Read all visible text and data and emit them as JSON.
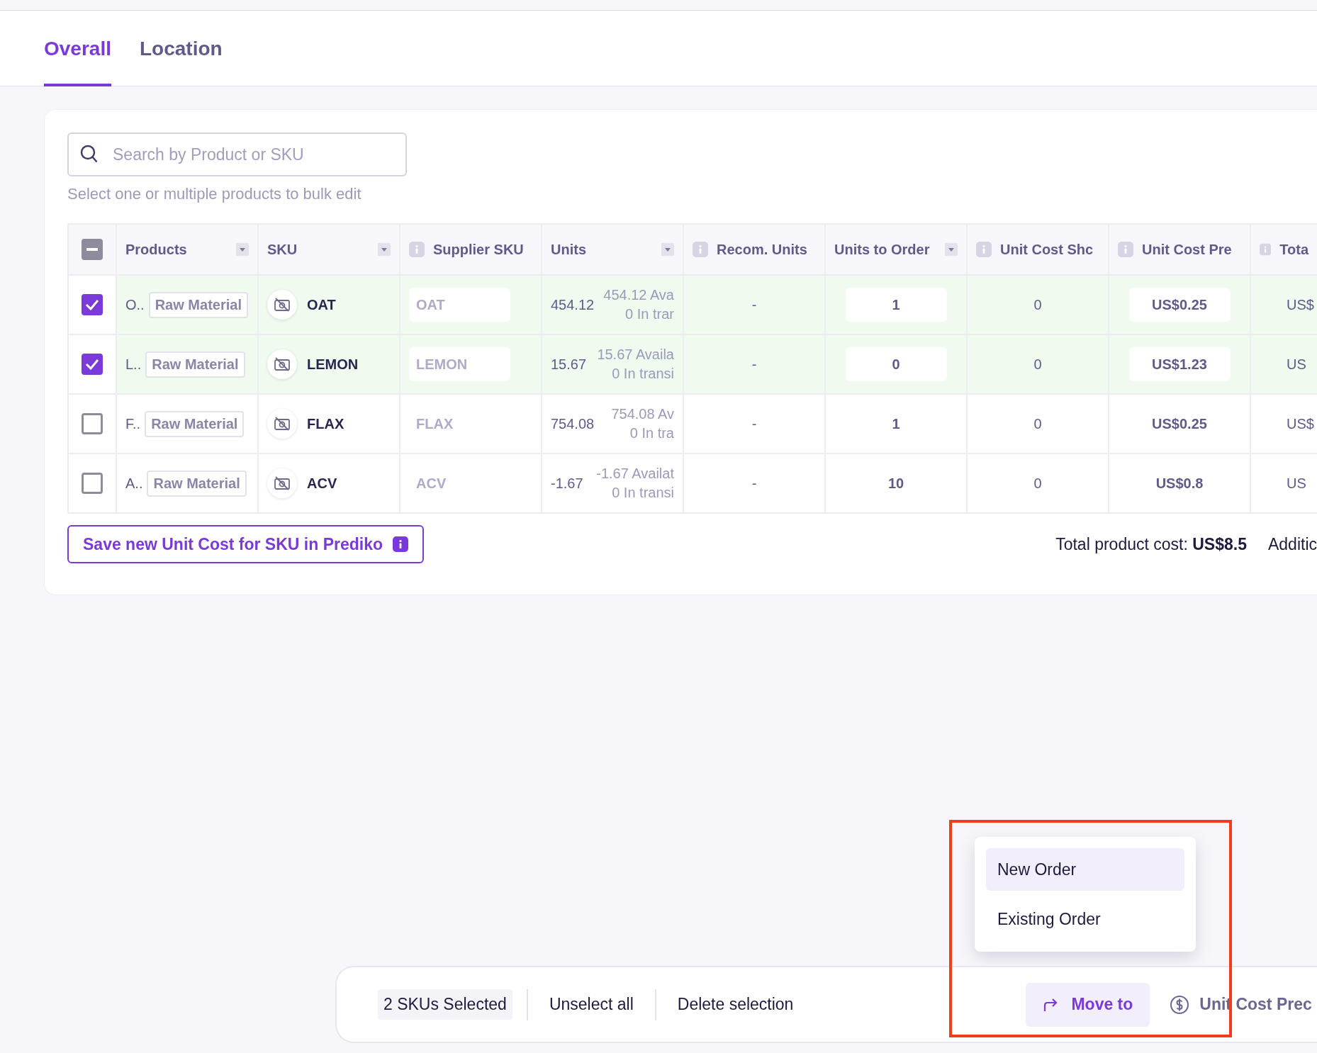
{
  "tabs": [
    {
      "label": "Overall",
      "selected": true
    },
    {
      "label": "Location",
      "selected": false
    }
  ],
  "search": {
    "placeholder": "Search by Product or SKU"
  },
  "helper_text": "Select one or multiple products to bulk edit",
  "table": {
    "select_all_partial": true,
    "columns": [
      {
        "label": "Products",
        "info": false,
        "sortable": true
      },
      {
        "label": "SKU",
        "info": false,
        "sortable": true
      },
      {
        "label": "Supplier SKU",
        "info": true,
        "sortable": false
      },
      {
        "label": "Units",
        "info": false,
        "sortable": true
      },
      {
        "label": "Recom. Units",
        "info": true,
        "sortable": false
      },
      {
        "label": "Units to Order",
        "info": false,
        "sortable": true
      },
      {
        "label": "Unit Cost Shc",
        "info": true,
        "sortable": false
      },
      {
        "label": "Unit Cost Pre",
        "info": true,
        "sortable": false
      },
      {
        "label": "Tota",
        "info": true,
        "sortable": false
      }
    ],
    "rows": [
      {
        "selected": true,
        "product": "O..",
        "category": "Raw Material",
        "sku": "OAT",
        "supplier_sku": "OAT",
        "units": "454.12",
        "available": "454.12 Ava",
        "in_transit": "0 In trar",
        "recom_units": "-",
        "units_to_order": "1",
        "unit_cost_shc": "0",
        "unit_cost_pre": "US$0.25",
        "total": "US$"
      },
      {
        "selected": true,
        "product": "L..",
        "category": "Raw Material",
        "sku": "LEMON",
        "supplier_sku": "LEMON",
        "units": "15.67",
        "available": "15.67 Availa",
        "in_transit": "0 In transi",
        "recom_units": "-",
        "units_to_order": "0",
        "unit_cost_shc": "0",
        "unit_cost_pre": "US$1.23",
        "total": "US"
      },
      {
        "selected": false,
        "product": "F..",
        "category": "Raw Material",
        "sku": "FLAX",
        "supplier_sku": "FLAX",
        "units": "754.08",
        "available": "754.08 Av",
        "in_transit": "0 In tra",
        "recom_units": "-",
        "units_to_order": "1",
        "unit_cost_shc": "0",
        "unit_cost_pre": "US$0.25",
        "total": "US$"
      },
      {
        "selected": false,
        "product": "A..",
        "category": "Raw Material",
        "sku": "ACV",
        "supplier_sku": "ACV",
        "units": "-1.67",
        "available": "-1.67 Availat",
        "in_transit": "0 In transi",
        "recom_units": "-",
        "units_to_order": "10",
        "unit_cost_shc": "0",
        "unit_cost_pre": "US$0.8",
        "total": "US"
      }
    ]
  },
  "save_button": "Save new Unit Cost for SKU in Prediko",
  "total_cost": "Total product cost: **US$8.5**",
  "additional": "Additic",
  "menu": {
    "items": [
      {
        "label": "New Order",
        "selected": true
      },
      {
        "label": "Existing Order",
        "selected": false
      }
    ]
  },
  "bulk_bar": {
    "count": "2 SKUs Selected",
    "unselect": "Unselect all",
    "delete": "Delete selection",
    "move_to": "Move to",
    "unit_cost": "Unit Cost Prec"
  }
}
